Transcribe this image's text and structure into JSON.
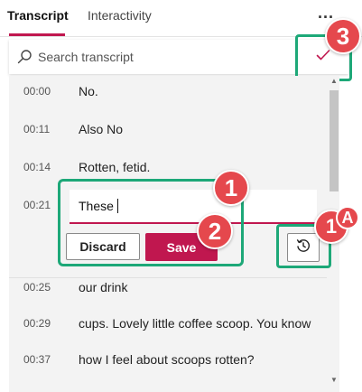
{
  "tabs": {
    "active_label": "Transcript",
    "inactive_label": "Interactivity",
    "more_label": "..."
  },
  "search": {
    "placeholder": "Search transcript",
    "icon": "search-icon"
  },
  "confirm_icon": "check-icon",
  "transcript": {
    "rows_before": [
      {
        "time": "00:00",
        "text": "No."
      },
      {
        "time": "00:11",
        "text": "Also No"
      },
      {
        "time": "00:14",
        "text": "Rotten, fetid."
      }
    ],
    "editing_row": {
      "time": "00:21",
      "value": "These"
    },
    "rows_after": [
      {
        "time": "00:25",
        "text": "our drink"
      },
      {
        "time": "00:29",
        "text": "cups. Lovely little coffee scoop. You know"
      },
      {
        "time": "00:37",
        "text": "how I feel about scoops rotten?"
      }
    ]
  },
  "edit_actions": {
    "discard_label": "Discard",
    "save_label": "Save",
    "revert_icon": "history-icon"
  },
  "callouts": {
    "one": "1",
    "two": "2",
    "three": "3",
    "one_a_number": "1",
    "one_a_letter": "A"
  },
  "colors": {
    "accent": "#c0174f",
    "highlight_frame": "#1da878",
    "callout": "#e5484d"
  }
}
